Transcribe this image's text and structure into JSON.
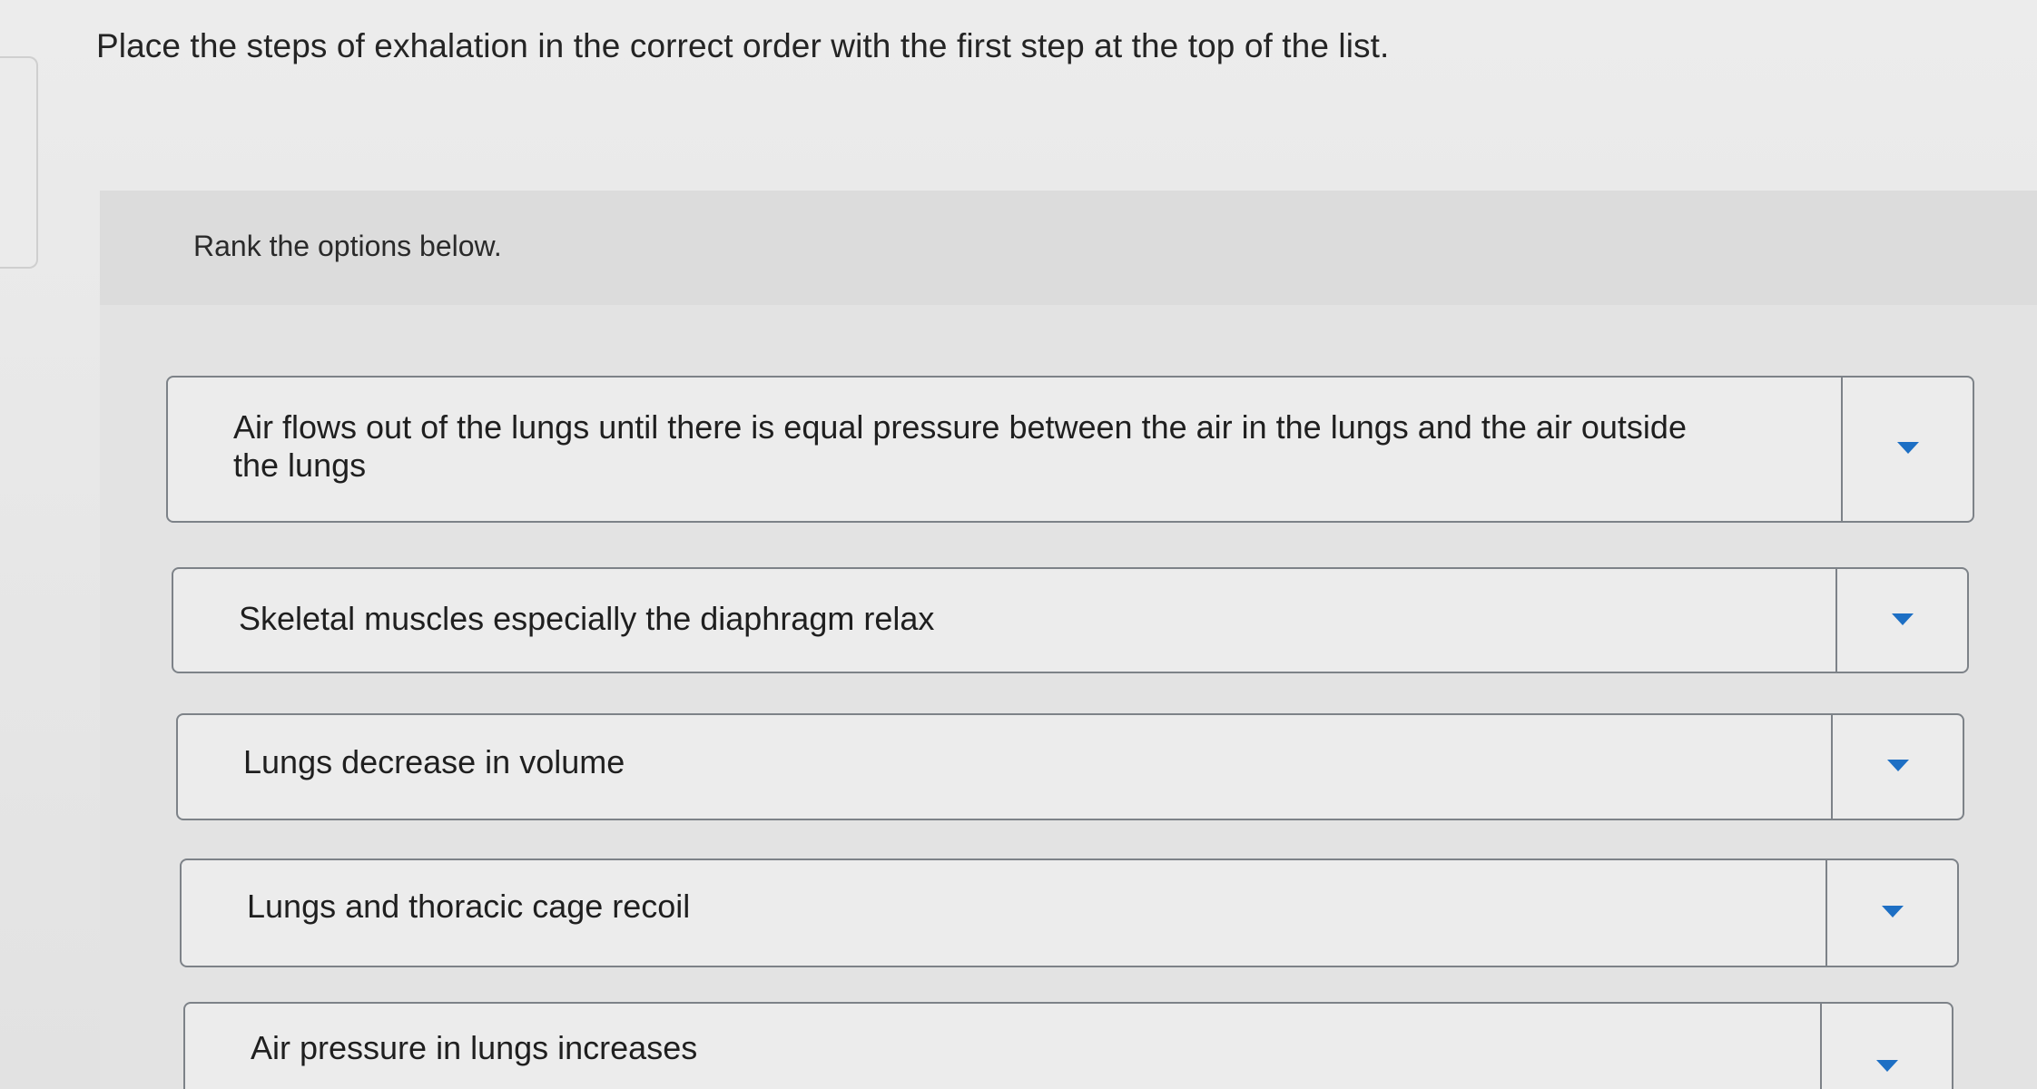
{
  "question": {
    "text": "Place the steps of exhalation in the correct order with the first step at the top of the list."
  },
  "rank": {
    "instruction": "Rank the options below.",
    "items": [
      {
        "label": "Air flows out of the lungs until there is equal pressure between the air in the lungs and the air outside the lungs"
      },
      {
        "label": "Skeletal muscles especially the diaphragm relax"
      },
      {
        "label": "Lungs decrease in volume"
      },
      {
        "label": "Lungs and thoracic cage recoil"
      },
      {
        "label": "Air pressure in lungs increases"
      }
    ],
    "dropdown_icon": "caret-down-icon",
    "accent_color": "#1d6fc4"
  }
}
